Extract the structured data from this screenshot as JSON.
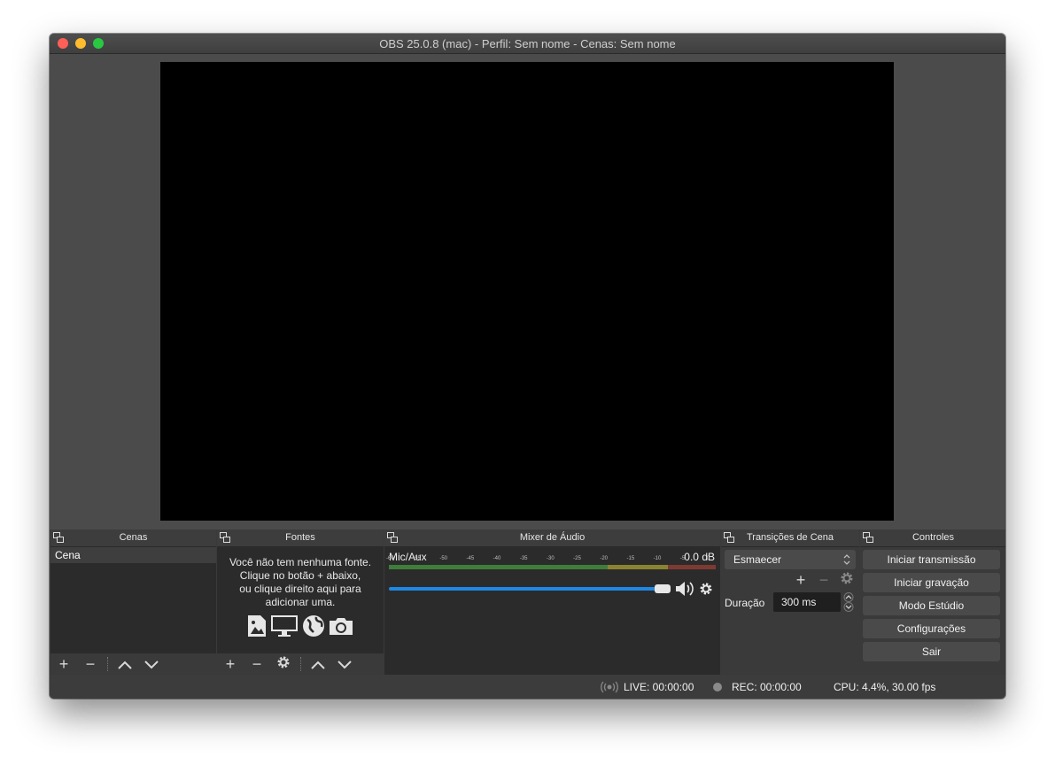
{
  "window": {
    "title": "OBS 25.0.8 (mac) - Perfil: Sem nome - Cenas: Sem nome",
    "traffic_colors": [
      "#fe5f57",
      "#febc2e",
      "#28c840"
    ]
  },
  "docks": {
    "scenes": {
      "title": "Cenas",
      "items": [
        "Cena"
      ]
    },
    "sources": {
      "title": "Fontes",
      "hint_lines": [
        "Você não tem nenhuma fonte.",
        "Clique no botão + abaixo,",
        "ou clique direito aqui para",
        "adicionar uma."
      ],
      "icons": [
        "image-icon",
        "monitor-icon",
        "globe-icon",
        "camera-icon"
      ]
    },
    "mixer": {
      "title": "Mixer de Áudio",
      "channel": {
        "name": "Mic/Aux",
        "level": "0.0 dB",
        "volume_fraction": 1.0,
        "ticks": [
          "-60",
          "-55",
          "-50",
          "-45",
          "-40",
          "-35",
          "-30",
          "-25",
          "-20",
          "-15",
          "-10",
          "-5",
          "0"
        ]
      }
    },
    "transitions": {
      "title": "Transições de Cena",
      "selected": "Esmaecer",
      "duration_label": "Duração",
      "duration_value": "300 ms"
    },
    "controls": {
      "title": "Controles",
      "buttons": [
        "Iniciar transmissão",
        "Iniciar gravação",
        "Modo Estúdio",
        "Configurações",
        "Sair"
      ]
    }
  },
  "status": {
    "live": "LIVE: 00:00:00",
    "rec": "REC: 00:00:00",
    "cpu": "CPU: 4.4%, 30.00 fps"
  },
  "colors": {
    "volume_blue": "#1e88e5",
    "meter_green": "#4caf50",
    "meter_yellow": "#c9b53a",
    "meter_red": "#c0392b"
  }
}
